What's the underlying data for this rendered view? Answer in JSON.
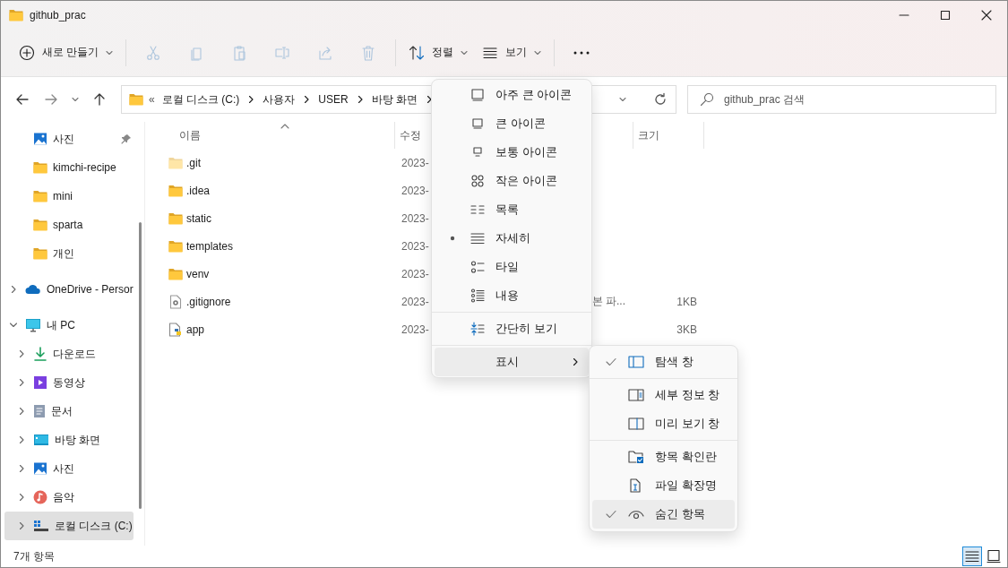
{
  "window": {
    "title": "github_prac"
  },
  "toolbar": [
    {
      "kind": "new",
      "label": "새로 만들기",
      "disabled": false
    },
    {
      "kind": "cut",
      "disabled": true
    },
    {
      "kind": "copy",
      "disabled": true
    },
    {
      "kind": "paste",
      "disabled": true
    },
    {
      "kind": "rename",
      "disabled": true
    },
    {
      "kind": "share",
      "disabled": true
    },
    {
      "kind": "delete",
      "disabled": true
    },
    {
      "kind": "sort",
      "label": "정렬",
      "disabled": false
    },
    {
      "kind": "view",
      "label": "보기",
      "disabled": false
    },
    {
      "kind": "more",
      "disabled": false
    }
  ],
  "address": {
    "overflow": "«",
    "crumbs": [
      "로컬 디스크 (C:)",
      "사용자",
      "USER",
      "바탕 화면"
    ]
  },
  "search": {
    "placeholder": "github_prac 검색"
  },
  "sidebar": {
    "sections": [
      [
        {
          "label": "사진",
          "kind": "pictures",
          "pinned": true,
          "selected": false
        },
        {
          "label": "kimchi-recipe",
          "kind": "folder",
          "pinned": false,
          "selected": false
        },
        {
          "label": "mini",
          "kind": "folder",
          "pinned": false,
          "selected": false
        },
        {
          "label": "sparta",
          "kind": "folder",
          "pinned": false,
          "selected": false
        },
        {
          "label": "개인",
          "kind": "folder",
          "pinned": false,
          "selected": false
        }
      ],
      [
        {
          "label": "OneDrive - Persor",
          "kind": "cloud",
          "expanded": false,
          "selected": false
        }
      ],
      [
        {
          "label": "내 PC",
          "kind": "pc",
          "expanded": true,
          "selected": false,
          "children": [
            {
              "label": "다운로드",
              "kind": "download",
              "expanded": false,
              "selected": false
            },
            {
              "label": "동영상",
              "kind": "video",
              "expanded": false,
              "selected": false
            },
            {
              "label": "문서",
              "kind": "document",
              "expanded": false,
              "selected": false
            },
            {
              "label": "바탕 화면",
              "kind": "desktop",
              "expanded": false,
              "selected": false
            },
            {
              "label": "사진",
              "kind": "pictures",
              "expanded": false,
              "selected": false
            },
            {
              "label": "음악",
              "kind": "music",
              "expanded": false,
              "selected": false
            },
            {
              "label": "로컬 디스크 (C:)",
              "kind": "drive",
              "expanded": false,
              "selected": true
            }
          ]
        }
      ]
    ]
  },
  "columns": [
    {
      "label": "이름",
      "sorted": true
    },
    {
      "label": "수정"
    },
    {
      "label": "크기"
    }
  ],
  "rows": [
    {
      "name": ".git",
      "kind": "folder",
      "hidden": true,
      "date": "2023-"
    },
    {
      "name": ".idea",
      "kind": "folder",
      "hidden": false,
      "date": "2023-"
    },
    {
      "name": "static",
      "kind": "folder",
      "hidden": false,
      "date": "2023-"
    },
    {
      "name": "templates",
      "kind": "folder",
      "hidden": false,
      "date": "2023-"
    },
    {
      "name": "venv",
      "kind": "folder",
      "hidden": false,
      "date": "2023-"
    },
    {
      "name": ".gitignore",
      "kind": "settings-file",
      "hidden": false,
      "date": "2023-",
      "type": "본 파...",
      "size": "1KB"
    },
    {
      "name": "app",
      "kind": "python-file",
      "hidden": false,
      "date": "2023-",
      "size": "3KB"
    }
  ],
  "view_menu": {
    "items": [
      {
        "kind": "extra-large",
        "label": "아주 큰 아이콘",
        "selected": false
      },
      {
        "kind": "large",
        "label": "큰 아이콘",
        "selected": false
      },
      {
        "kind": "medium",
        "label": "보통 아이콘",
        "selected": false
      },
      {
        "kind": "small",
        "label": "작은 아이콘",
        "selected": false
      },
      {
        "kind": "list",
        "label": "목록",
        "selected": false
      },
      {
        "kind": "details",
        "label": "자세히",
        "selected": true
      },
      {
        "kind": "tiles",
        "label": "타일",
        "selected": false
      },
      {
        "kind": "content",
        "label": "내용",
        "selected": false
      }
    ],
    "compact": {
      "label": "간단히 보기"
    },
    "show": {
      "label": "표시",
      "expanded": true
    }
  },
  "show_menu": {
    "groups": [
      [
        {
          "kind": "nav-pane",
          "label": "탐색 창",
          "checked": true,
          "highlighted": false
        }
      ],
      [
        {
          "kind": "details-pane",
          "label": "세부 정보 창",
          "checked": false,
          "highlighted": false
        },
        {
          "kind": "preview-pane",
          "label": "미리 보기 창",
          "checked": false,
          "highlighted": false
        }
      ],
      [
        {
          "kind": "checkboxes",
          "label": "항목 확인란",
          "checked": false,
          "highlighted": false
        },
        {
          "kind": "extensions",
          "label": "파일 확장명",
          "checked": false,
          "highlighted": false
        },
        {
          "kind": "hidden",
          "label": "숨긴 항목",
          "checked": true,
          "highlighted": true
        }
      ]
    ]
  },
  "status_bar": {
    "count": "7개 항목",
    "views": [
      {
        "kind": "details",
        "selected": true
      },
      {
        "kind": "large",
        "selected": false
      }
    ]
  }
}
